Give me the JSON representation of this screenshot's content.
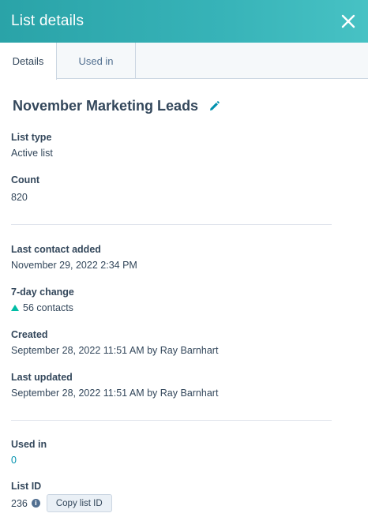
{
  "header": {
    "title": "List details",
    "close_icon": "close-icon"
  },
  "tabs": [
    {
      "label": "Details",
      "active": true
    },
    {
      "label": "Used in",
      "active": false
    }
  ],
  "list": {
    "name": "November Marketing Leads",
    "edit_icon": "pencil-icon"
  },
  "fields": {
    "list_type": {
      "label": "List type",
      "value": "Active list"
    },
    "count": {
      "label": "Count",
      "value": "820"
    },
    "last_contact_added": {
      "label": "Last contact added",
      "value": "November 29, 2022 2:34 PM"
    },
    "seven_day_change": {
      "label": "7-day change",
      "value": "56 contacts",
      "icon": "triangle-up-icon"
    },
    "created": {
      "label": "Created",
      "value": "September 28, 2022 11:51 AM by Ray Barnhart"
    },
    "last_updated": {
      "label": "Last updated",
      "value": "September 28, 2022 11:51 AM by Ray Barnhart"
    },
    "used_in": {
      "label": "Used in",
      "value": "0"
    },
    "list_id": {
      "label": "List ID",
      "value": "236",
      "info_icon": "i",
      "copy_label": "Copy list ID"
    }
  },
  "colors": {
    "header_start": "#2aa3a8",
    "header_end": "#47c2c4",
    "accent": "#0091ae",
    "text": "#33475b",
    "up_arrow": "#00bda5"
  }
}
